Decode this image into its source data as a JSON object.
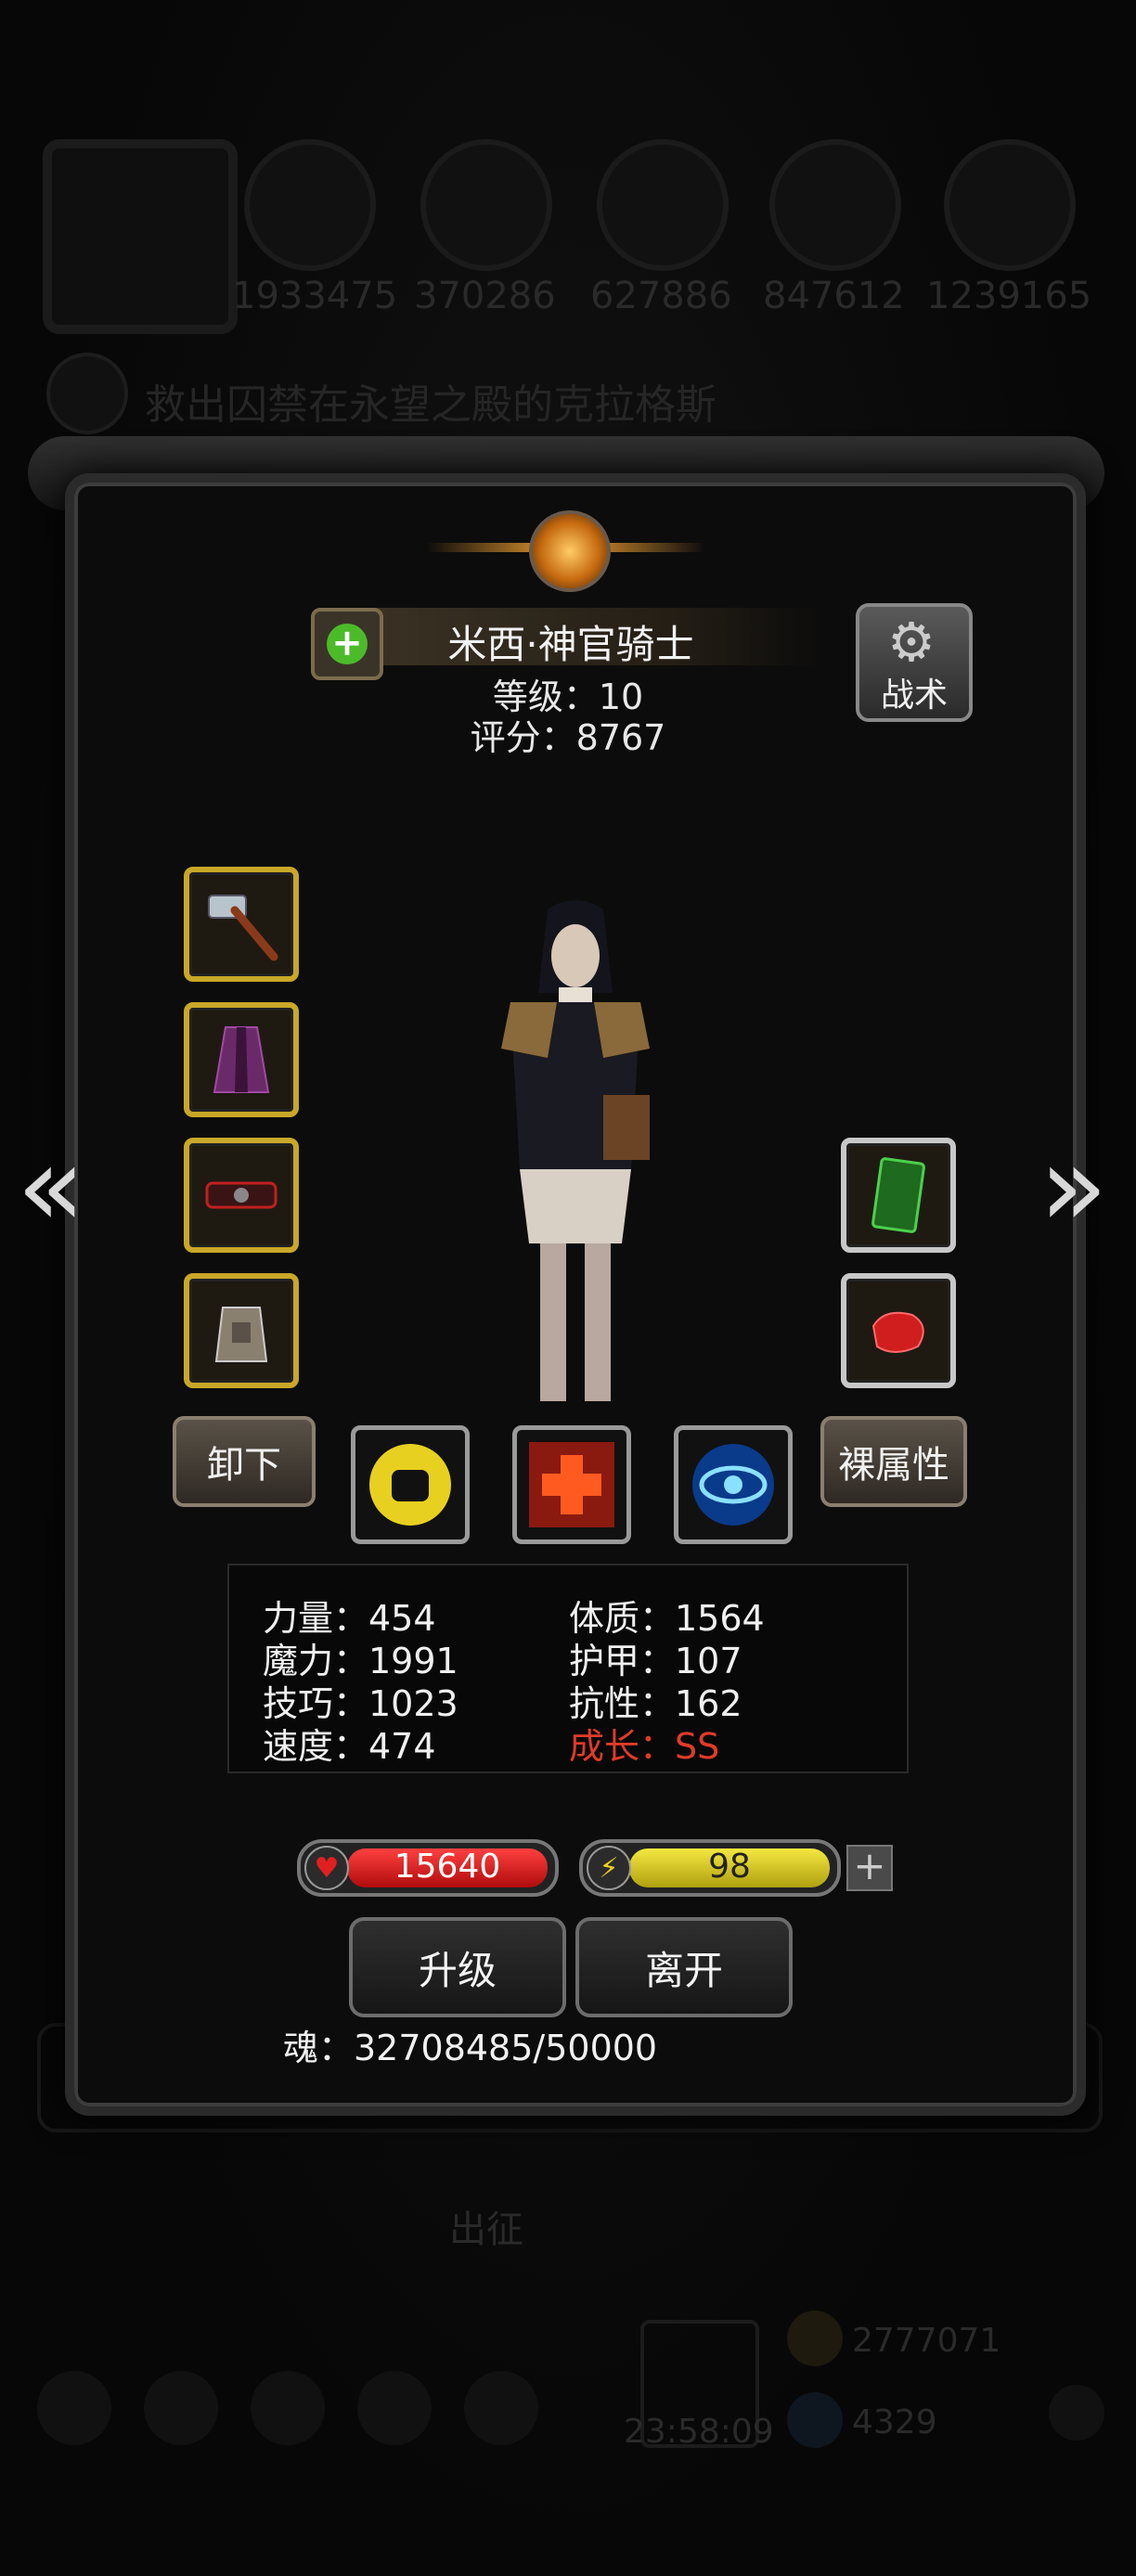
{
  "background": {
    "resources": [
      "1933475",
      "370286",
      "627886",
      "847612",
      "1239165"
    ],
    "quest_text": "救出囚禁在永望之殿的克拉格斯",
    "march_label": "出征",
    "gold": "2777071",
    "gems": "4329",
    "timer": "23:58:09"
  },
  "character": {
    "name": "米西·神官骑士",
    "level": "等级：10",
    "score": "评分：8767"
  },
  "buttons": {
    "tactics": "战术",
    "unequip": "卸下",
    "base_attributes": "裸属性",
    "upgrade": "升级",
    "leave": "离开"
  },
  "stats": {
    "strength": "力量：454",
    "magic": "魔力：1991",
    "skill": "技巧：1023",
    "speed": "速度：474",
    "constitution": "体质：1564",
    "armor": "护甲：107",
    "resistance": "抗性：162",
    "growth": "成长：SS"
  },
  "bars": {
    "hp": "15640",
    "stamina": "98"
  },
  "soul": "魂：32708485/50000",
  "colors": {
    "equip_border_gold": "#c9a728",
    "growth_red": "#e23a2a",
    "hp_red": "#d21818",
    "stamina_yellow": "#e0d020"
  }
}
